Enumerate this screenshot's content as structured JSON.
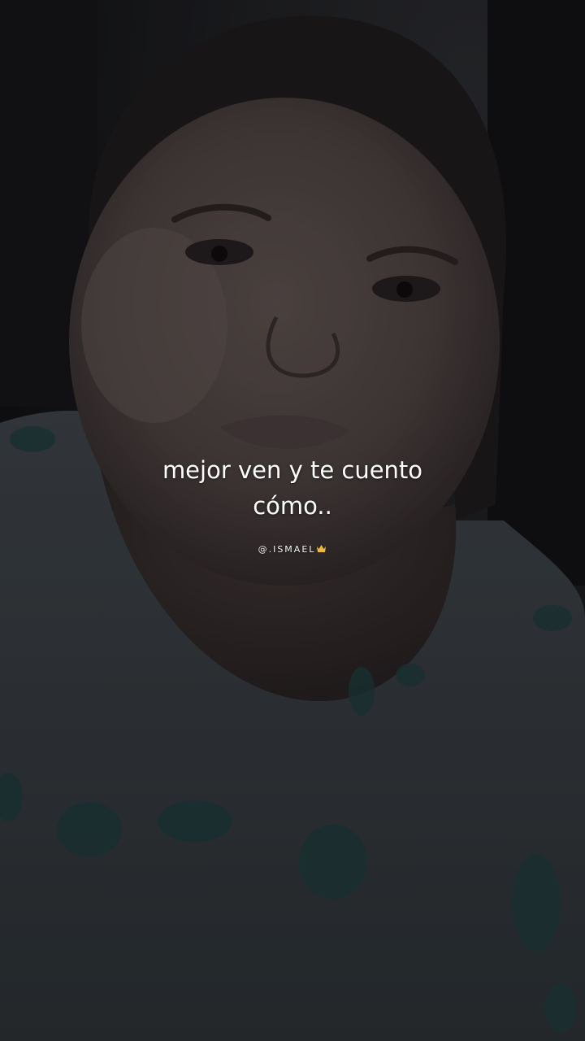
{
  "caption": {
    "line1": "mejor ven y te cuento",
    "line2": "cómo.."
  },
  "watermark": {
    "handle": "@.ISMAEL",
    "icon": "crown-icon"
  },
  "colors": {
    "caption_text": "#ffffff",
    "crown": "#e8b93a"
  }
}
